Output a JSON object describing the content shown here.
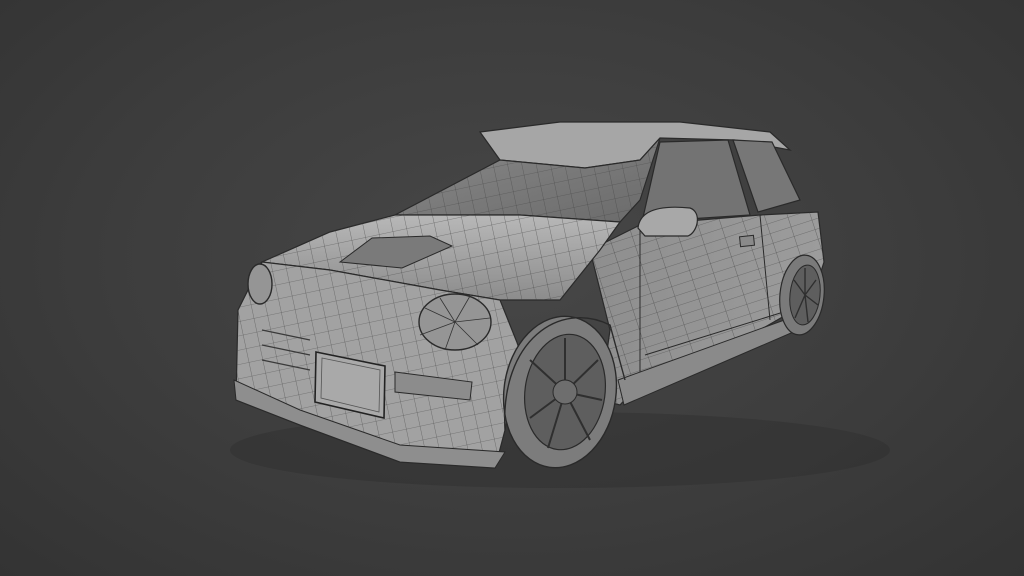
{
  "scene": {
    "subject": "car-wireframe-model",
    "colors": {
      "background": "#3d3d3d",
      "body": "#9a9a9a",
      "body_light": "#b4b4b4",
      "wire": "#2e2e2e",
      "glass": "#6e6e6e",
      "tire": "#8a8a8a"
    }
  }
}
